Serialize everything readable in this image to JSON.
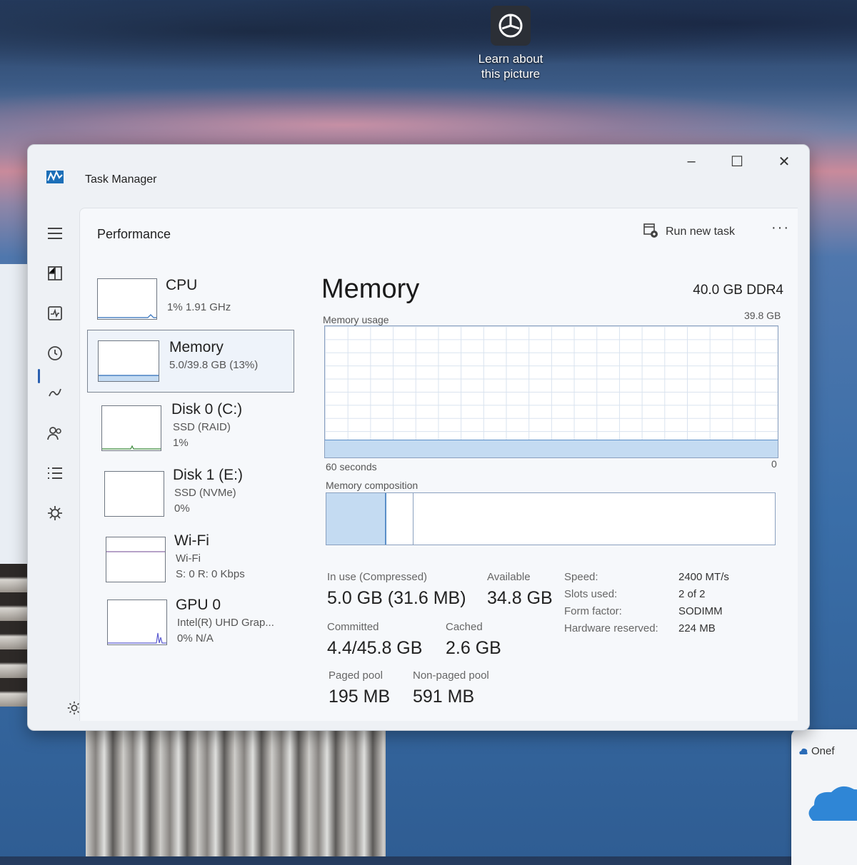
{
  "desktop": {
    "learn_label": "Learn about\nthis picture",
    "onedrive_label": "Onef"
  },
  "window": {
    "title": "Task Manager",
    "controls": {
      "minimize": "–",
      "maximize": "☐",
      "close": "✕"
    }
  },
  "nav": {
    "items": [
      "menu-icon",
      "processes-icon",
      "performance-icon",
      "app-history-icon",
      "startup-apps-icon",
      "users-icon",
      "details-icon",
      "services-icon"
    ],
    "active_index": 2
  },
  "header": {
    "page_title": "Performance",
    "run_task_label": "Run new task",
    "more_label": "···"
  },
  "sidebar": {
    "items": [
      {
        "name": "CPU",
        "sub1": "1% 1.91 GHz",
        "sub2": "",
        "sub3": ""
      },
      {
        "name": "Memory",
        "sub1": "5.0/39.8 GB (13%)",
        "sub2": "",
        "sub3": ""
      },
      {
        "name": "Disk 0 (C:)",
        "sub1": "SSD (RAID)",
        "sub2": "1%",
        "sub3": ""
      },
      {
        "name": "Disk 1 (E:)",
        "sub1": "SSD (NVMe)",
        "sub2": "0%",
        "sub3": ""
      },
      {
        "name": "Wi-Fi",
        "sub1": "Wi-Fi",
        "sub2": "S: 0 R: 0 Kbps",
        "sub3": ""
      },
      {
        "name": "GPU 0",
        "sub1": "Intel(R) UHD Grap...",
        "sub2": "0% N/A",
        "sub3": ""
      }
    ],
    "selected": 1
  },
  "memory": {
    "title": "Memory",
    "total_spec": "40.0 GB DDR4",
    "usage_label": "Memory usage",
    "max_label": "39.8 GB",
    "time_label": "60 seconds",
    "zero_label": "0",
    "usage_fraction": 0.13,
    "composition_label": "Memory composition",
    "composition": {
      "in_use_fraction": 0.13,
      "modified_fraction": 0.06
    },
    "stats": {
      "in_use_label": "In use (Compressed)",
      "in_use_value": "5.0 GB (31.6 MB)",
      "available_label": "Available",
      "available_value": "34.8 GB",
      "committed_label": "Committed",
      "committed_value": "4.4/45.8 GB",
      "cached_label": "Cached",
      "cached_value": "2.6 GB",
      "paged_label": "Paged pool",
      "paged_value": "195 MB",
      "nonpaged_label": "Non-paged pool",
      "nonpaged_value": "591 MB"
    },
    "specs": [
      {
        "key": "Speed:",
        "value": "2400 MT/s"
      },
      {
        "key": "Slots used:",
        "value": "2 of 2"
      },
      {
        "key": "Form factor:",
        "value": "SODIMM"
      },
      {
        "key": "Hardware reserved:",
        "value": "224 MB"
      }
    ]
  },
  "colors": {
    "accent": "#2a5fb0",
    "graph_fill": "#c4dbf2",
    "graph_line": "#5b8fc8"
  }
}
